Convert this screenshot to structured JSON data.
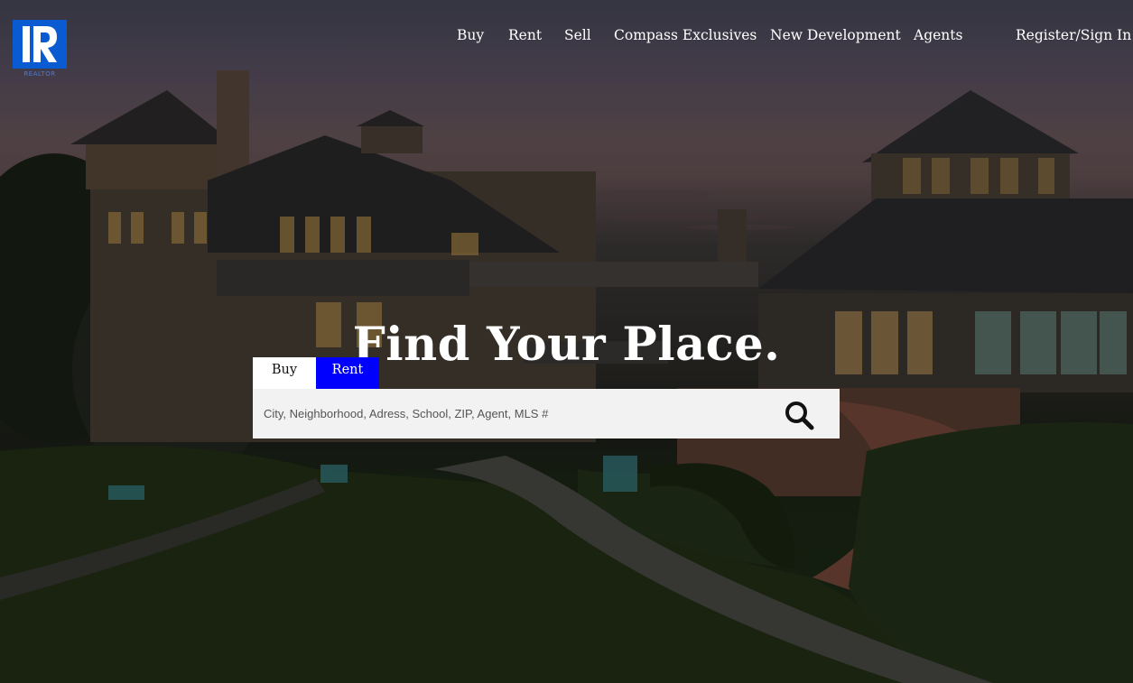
{
  "brand": {
    "logo_letter": "R",
    "logo_caption": "REALTOR",
    "logo_color": "#0a5bd1"
  },
  "nav": {
    "items": [
      {
        "label": "Buy"
      },
      {
        "label": "Rent"
      },
      {
        "label": "Sell"
      },
      {
        "label": "Compass Exclusives"
      },
      {
        "label": "New Development"
      },
      {
        "label": "Agents"
      }
    ],
    "account_label": "Register/Sign In"
  },
  "hero": {
    "headline": "Find Your Place."
  },
  "search": {
    "tabs": [
      {
        "label": "Buy",
        "active": false
      },
      {
        "label": "Rent",
        "active": true
      }
    ],
    "placeholder": "City, Neighborhood, Adress, School, ZIP, Agent, MLS #",
    "value": "",
    "button_icon": "search-icon",
    "active_tab_color": "#0000ff"
  }
}
